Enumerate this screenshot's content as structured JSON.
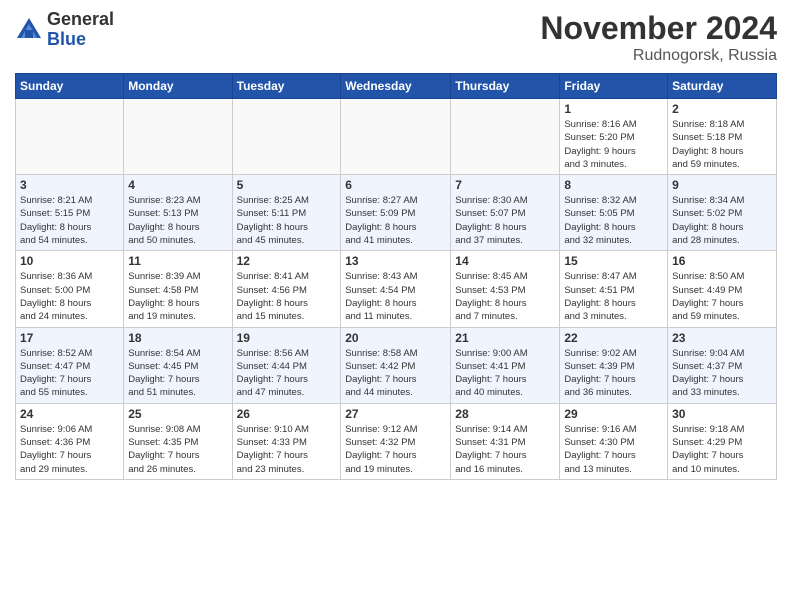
{
  "header": {
    "logo_general": "General",
    "logo_blue": "Blue",
    "month_title": "November 2024",
    "location": "Rudnogorsk, Russia"
  },
  "days_of_week": [
    "Sunday",
    "Monday",
    "Tuesday",
    "Wednesday",
    "Thursday",
    "Friday",
    "Saturday"
  ],
  "weeks": [
    {
      "shaded": false,
      "days": [
        {
          "num": "",
          "info": ""
        },
        {
          "num": "",
          "info": ""
        },
        {
          "num": "",
          "info": ""
        },
        {
          "num": "",
          "info": ""
        },
        {
          "num": "",
          "info": ""
        },
        {
          "num": "1",
          "info": "Sunrise: 8:16 AM\nSunset: 5:20 PM\nDaylight: 9 hours\nand 3 minutes."
        },
        {
          "num": "2",
          "info": "Sunrise: 8:18 AM\nSunset: 5:18 PM\nDaylight: 8 hours\nand 59 minutes."
        }
      ]
    },
    {
      "shaded": true,
      "days": [
        {
          "num": "3",
          "info": "Sunrise: 8:21 AM\nSunset: 5:15 PM\nDaylight: 8 hours\nand 54 minutes."
        },
        {
          "num": "4",
          "info": "Sunrise: 8:23 AM\nSunset: 5:13 PM\nDaylight: 8 hours\nand 50 minutes."
        },
        {
          "num": "5",
          "info": "Sunrise: 8:25 AM\nSunset: 5:11 PM\nDaylight: 8 hours\nand 45 minutes."
        },
        {
          "num": "6",
          "info": "Sunrise: 8:27 AM\nSunset: 5:09 PM\nDaylight: 8 hours\nand 41 minutes."
        },
        {
          "num": "7",
          "info": "Sunrise: 8:30 AM\nSunset: 5:07 PM\nDaylight: 8 hours\nand 37 minutes."
        },
        {
          "num": "8",
          "info": "Sunrise: 8:32 AM\nSunset: 5:05 PM\nDaylight: 8 hours\nand 32 minutes."
        },
        {
          "num": "9",
          "info": "Sunrise: 8:34 AM\nSunset: 5:02 PM\nDaylight: 8 hours\nand 28 minutes."
        }
      ]
    },
    {
      "shaded": false,
      "days": [
        {
          "num": "10",
          "info": "Sunrise: 8:36 AM\nSunset: 5:00 PM\nDaylight: 8 hours\nand 24 minutes."
        },
        {
          "num": "11",
          "info": "Sunrise: 8:39 AM\nSunset: 4:58 PM\nDaylight: 8 hours\nand 19 minutes."
        },
        {
          "num": "12",
          "info": "Sunrise: 8:41 AM\nSunset: 4:56 PM\nDaylight: 8 hours\nand 15 minutes."
        },
        {
          "num": "13",
          "info": "Sunrise: 8:43 AM\nSunset: 4:54 PM\nDaylight: 8 hours\nand 11 minutes."
        },
        {
          "num": "14",
          "info": "Sunrise: 8:45 AM\nSunset: 4:53 PM\nDaylight: 8 hours\nand 7 minutes."
        },
        {
          "num": "15",
          "info": "Sunrise: 8:47 AM\nSunset: 4:51 PM\nDaylight: 8 hours\nand 3 minutes."
        },
        {
          "num": "16",
          "info": "Sunrise: 8:50 AM\nSunset: 4:49 PM\nDaylight: 7 hours\nand 59 minutes."
        }
      ]
    },
    {
      "shaded": true,
      "days": [
        {
          "num": "17",
          "info": "Sunrise: 8:52 AM\nSunset: 4:47 PM\nDaylight: 7 hours\nand 55 minutes."
        },
        {
          "num": "18",
          "info": "Sunrise: 8:54 AM\nSunset: 4:45 PM\nDaylight: 7 hours\nand 51 minutes."
        },
        {
          "num": "19",
          "info": "Sunrise: 8:56 AM\nSunset: 4:44 PM\nDaylight: 7 hours\nand 47 minutes."
        },
        {
          "num": "20",
          "info": "Sunrise: 8:58 AM\nSunset: 4:42 PM\nDaylight: 7 hours\nand 44 minutes."
        },
        {
          "num": "21",
          "info": "Sunrise: 9:00 AM\nSunset: 4:41 PM\nDaylight: 7 hours\nand 40 minutes."
        },
        {
          "num": "22",
          "info": "Sunrise: 9:02 AM\nSunset: 4:39 PM\nDaylight: 7 hours\nand 36 minutes."
        },
        {
          "num": "23",
          "info": "Sunrise: 9:04 AM\nSunset: 4:37 PM\nDaylight: 7 hours\nand 33 minutes."
        }
      ]
    },
    {
      "shaded": false,
      "days": [
        {
          "num": "24",
          "info": "Sunrise: 9:06 AM\nSunset: 4:36 PM\nDaylight: 7 hours\nand 29 minutes."
        },
        {
          "num": "25",
          "info": "Sunrise: 9:08 AM\nSunset: 4:35 PM\nDaylight: 7 hours\nand 26 minutes."
        },
        {
          "num": "26",
          "info": "Sunrise: 9:10 AM\nSunset: 4:33 PM\nDaylight: 7 hours\nand 23 minutes."
        },
        {
          "num": "27",
          "info": "Sunrise: 9:12 AM\nSunset: 4:32 PM\nDaylight: 7 hours\nand 19 minutes."
        },
        {
          "num": "28",
          "info": "Sunrise: 9:14 AM\nSunset: 4:31 PM\nDaylight: 7 hours\nand 16 minutes."
        },
        {
          "num": "29",
          "info": "Sunrise: 9:16 AM\nSunset: 4:30 PM\nDaylight: 7 hours\nand 13 minutes."
        },
        {
          "num": "30",
          "info": "Sunrise: 9:18 AM\nSunset: 4:29 PM\nDaylight: 7 hours\nand 10 minutes."
        }
      ]
    }
  ]
}
